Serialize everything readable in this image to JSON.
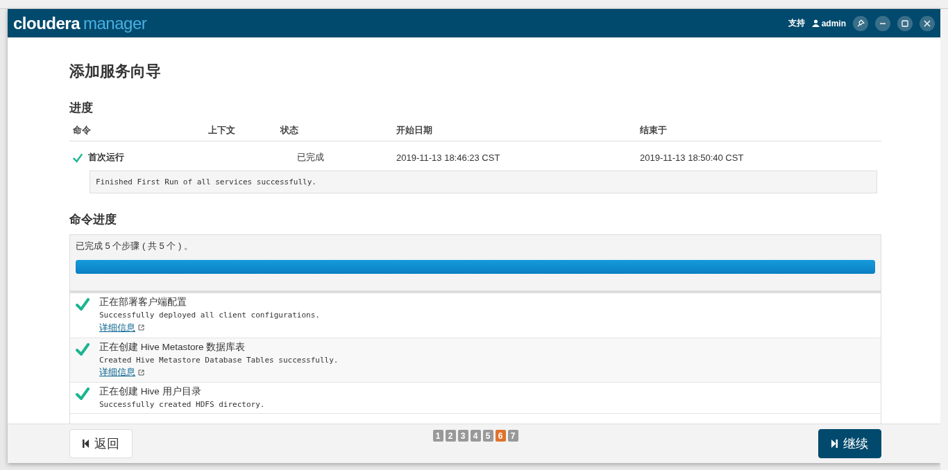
{
  "header": {
    "logo": {
      "brand": "cloudera",
      "product": "manager"
    },
    "support": "支持",
    "user": "admin"
  },
  "title": "添加服务向导",
  "progress": {
    "heading": "进度",
    "columns": [
      "命令",
      "上下文",
      "状态",
      "开始日期",
      "结束于"
    ],
    "rows": [
      {
        "command": "首次运行",
        "context": "",
        "status": "已完成",
        "start": "2019-11-13 18:46:23 CST",
        "end": "2019-11-13 18:50:40 CST",
        "message": "Finished First Run of all services successfully."
      }
    ]
  },
  "command_progress": {
    "heading": "命令进度",
    "summary": "已完成 5 个步骤 ( 共 5 个 ) 。",
    "level": 1,
    "steps": [
      {
        "title": "正在部署客户端配置",
        "detail": "Successfully deployed all client configurations.",
        "link": "详细信息"
      },
      {
        "title": "正在创建 Hive Metastore 数据库表",
        "detail": "Created Hive Metastore Database Tables successfully.",
        "link": "详细信息"
      },
      {
        "title": "正在创建 Hive 用户目录",
        "detail": "Successfully created HDFS directory."
      }
    ]
  },
  "footer": {
    "back": "返回",
    "continue": "继续",
    "pages": [
      {
        "label": "1",
        "selected": false
      },
      {
        "label": "2",
        "selected": false
      },
      {
        "label": "3",
        "selected": false
      },
      {
        "label": "4",
        "selected": false
      },
      {
        "label": "5",
        "selected": false
      },
      {
        "label": "6",
        "selected": true
      },
      {
        "label": "7",
        "selected": false
      }
    ]
  }
}
